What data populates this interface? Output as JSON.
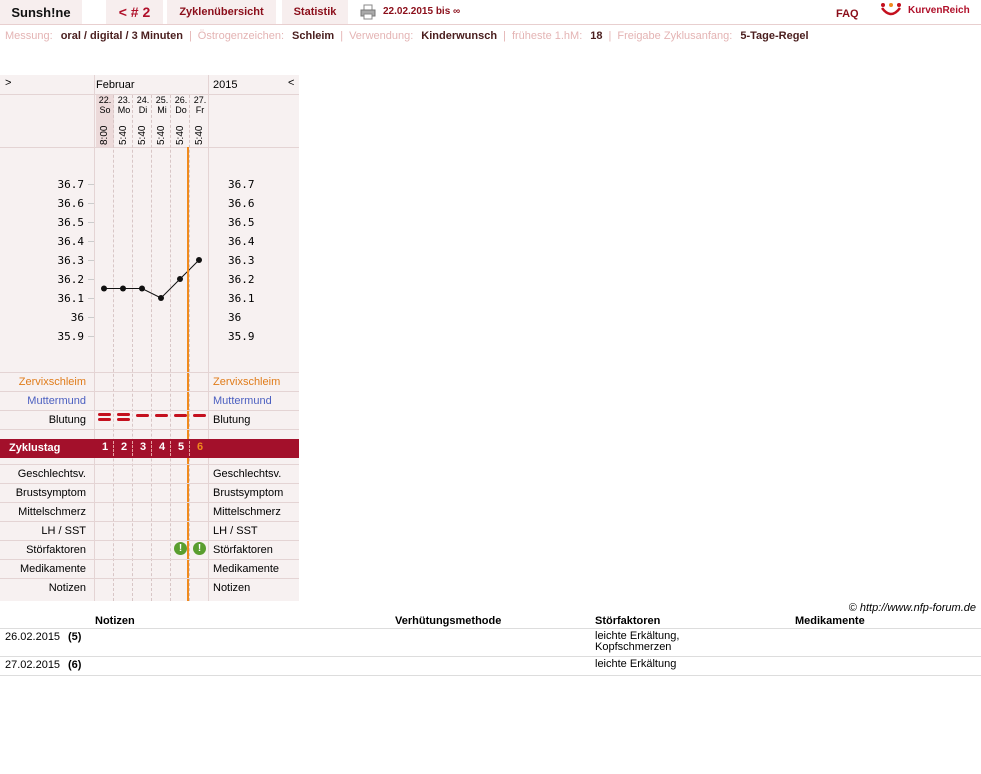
{
  "top": {
    "brand": "Sunsh!ne",
    "cycle_nr": "< # 2",
    "overview": "Zyklenübersicht",
    "statistics": "Statistik",
    "date_range": "22.02.2015 bis ∞",
    "faq": "FAQ",
    "logo_text": "KurvenReich"
  },
  "info": {
    "messung_label": "Messung:",
    "messung_value": "oral / digital / 3 Minuten",
    "oestrogen_label": "Östrogenzeichen:",
    "oestrogen_value": "Schleim",
    "verwendung_label": "Verwendung:",
    "verwendung_value": "Kinderwunsch",
    "fhm_label": "früheste 1.hM:",
    "fhm_value": "18",
    "freigabe_label": "Freigabe Zyklusanfang:",
    "freigabe_value": "5-Tage-Regel"
  },
  "chart": {
    "nav_prev": ">",
    "nav_next": "<",
    "month": "Februar",
    "year": "2015",
    "days": [
      {
        "date": "22.",
        "weekday": "So",
        "time": "8:00"
      },
      {
        "date": "23.",
        "weekday": "Mo",
        "time": "5:40"
      },
      {
        "date": "24.",
        "weekday": "Di",
        "time": "5:40"
      },
      {
        "date": "25.",
        "weekday": "Mi",
        "time": "5:40"
      },
      {
        "date": "26.",
        "weekday": "Do",
        "time": "5:40"
      },
      {
        "date": "27.",
        "weekday": "Fr",
        "time": "5:40"
      }
    ],
    "temp_labels": [
      "36.7",
      "36.6",
      "36.5",
      "36.4",
      "36.3",
      "36.2",
      "36.1",
      "36",
      "35.9"
    ],
    "temperatures": [
      36.15,
      36.15,
      36.15,
      36.1,
      36.2,
      36.3
    ],
    "zervix_label": "Zervixschleim",
    "muttermund_label": "Muttermund",
    "blutung_label": "Blutung",
    "bleeding_intensity": [
      2,
      2,
      1,
      1,
      1,
      1
    ],
    "zyklustag_label": "Zyklustag",
    "cycle_days": [
      "1",
      "2",
      "3",
      "4",
      "5",
      "6"
    ],
    "lower_rows": [
      "Geschlechtsv.",
      "Brustsymptom",
      "Mittelschmerz",
      "LH / SST",
      "Störfaktoren",
      "Medikamente",
      "Notizen"
    ],
    "stoerfaktoren_flags": [
      false,
      false,
      false,
      false,
      true,
      true
    ],
    "colors": {
      "zervix": "#e07c1a",
      "muttermund": "#4b5fc0",
      "cycle_bar": "#a3102b",
      "current_day_line": "#f08a1d",
      "flag": "#5a9e2f",
      "bleeding": "#c4101e"
    }
  },
  "copyright": "© http://www.nfp-forum.de",
  "notes_table": {
    "headers": [
      "Notizen",
      "Verhütungsmethode",
      "Störfaktoren",
      "Medikamente"
    ],
    "rows": [
      {
        "date": "26.02.2015",
        "day": "(5)",
        "notizen": "",
        "verhuetung": "",
        "stoerfaktoren": "leichte Erkältung, Kopfschmerzen",
        "medikamente": ""
      },
      {
        "date": "27.02.2015",
        "day": "(6)",
        "notizen": "",
        "verhuetung": "",
        "stoerfaktoren": "leichte Erkältung",
        "medikamente": ""
      }
    ]
  }
}
